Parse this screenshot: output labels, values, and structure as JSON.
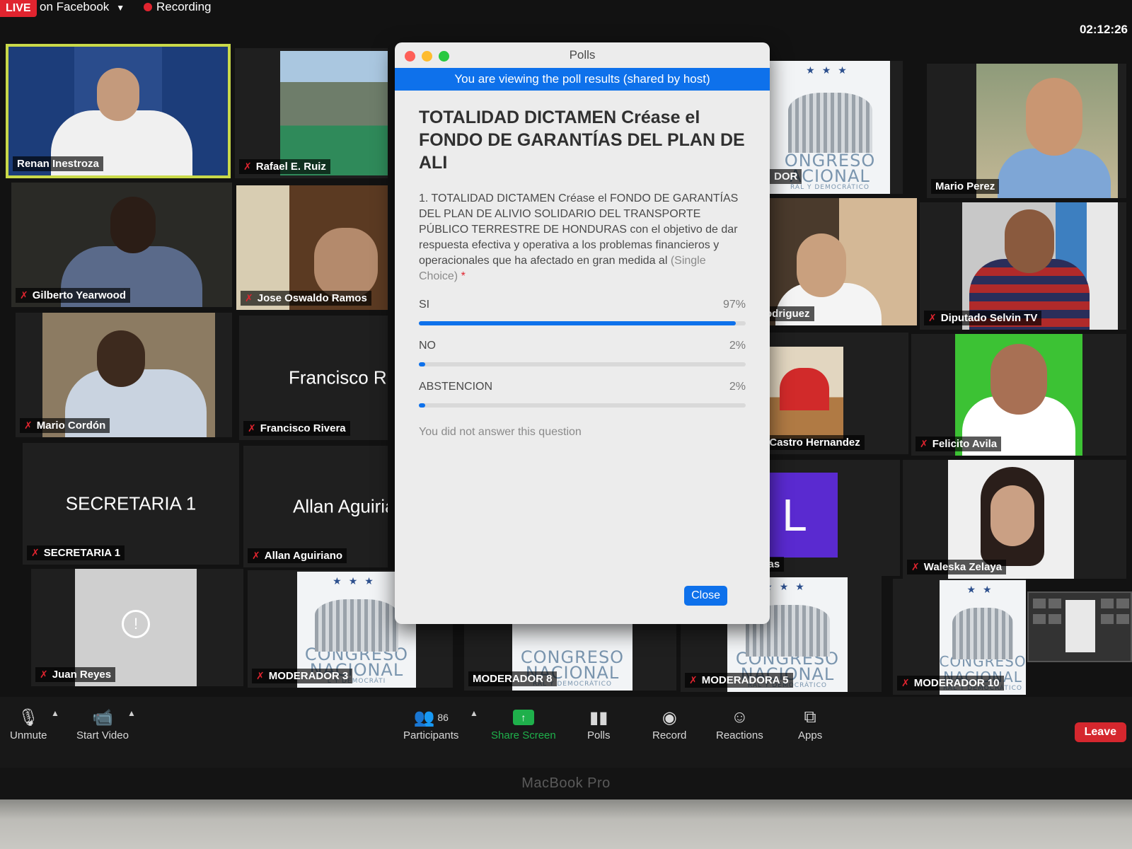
{
  "top_bar": {
    "live_label": "LIVE",
    "on_facebook": "on Facebook",
    "recording": "Recording",
    "clock": "02:12:26"
  },
  "tiles": [
    {
      "name": "Renan Inestroza"
    },
    {
      "name": "Rafael E. Ruiz"
    },
    {
      "name": "Gilberto Yearwood"
    },
    {
      "name": "Jose Oswaldo Ramos"
    },
    {
      "name": "Mario Cordón"
    },
    {
      "name": "Francisco Rivera",
      "center": "Francisco Riv"
    },
    {
      "name": "SECRETARIA 1",
      "center": "SECRETARIA 1"
    },
    {
      "name": "Allan Aguiriano",
      "center": "Allan Aguiria"
    },
    {
      "name": "Juan Reyes"
    },
    {
      "name": "MODERADOR 3"
    },
    {
      "name": "MODERADOR 8"
    },
    {
      "name": "MODERADORA 5"
    },
    {
      "name": "MODERADOR 10"
    },
    {
      "name": "Mario Perez"
    },
    {
      "name": "Diputado Selvin TV"
    },
    {
      "name": "Felicito Avila"
    },
    {
      "name": "Waleska Zelaya"
    },
    {
      "name": "DOR"
    },
    {
      "name": "odriguez"
    },
    {
      "name": "n Castro Hernandez"
    },
    {
      "name": "egas",
      "avatar_letter": "L"
    }
  ],
  "logo": {
    "line1": "CONGRESO",
    "line2": "NACIONAL",
    "line3": "RAL Y DEMOCRÁTICO",
    "line3_variant": "L Y DEMOCRÁTI",
    "logo1_line1": "ONGRESO",
    "logo1_line2": "ACIONAL"
  },
  "avila_banner": "CITO AVILA",
  "poll": {
    "window_title": "Polls",
    "shared_banner": "You are viewing the poll results (shared by host)",
    "title": "TOTALIDAD DICTAMEN  Créase el FONDO DE GARANTÍAS DEL PLAN DE ALI",
    "question": "1. TOTALIDAD DICTAMEN  Créase el FONDO DE GARANTÍAS DEL PLAN DE ALIVIO SOLIDARIO DEL TRANSPORTE PÚBLICO TERRESTRE DE HONDURAS con el objetivo de dar respuesta efectiva y operativa a los problemas financieros y operacionales que ha afectado en gran medida al",
    "choice_type": "(Single Choice)",
    "required": "*",
    "options": [
      {
        "label": "SI",
        "percent_label": "97%",
        "percent": 97
      },
      {
        "label": "NO",
        "percent_label": "2%",
        "percent": 2
      },
      {
        "label": "ABSTENCION",
        "percent_label": "2%",
        "percent": 2
      }
    ],
    "no_answer": "You did not answer this question",
    "close_label": "Close"
  },
  "toolbar": {
    "unmute": "Unmute",
    "start_video": "Start Video",
    "participants": "Participants",
    "participant_count": "86",
    "share_screen": "Share Screen",
    "polls": "Polls",
    "record": "Record",
    "reactions": "Reactions",
    "apps": "Apps",
    "leave": "Leave"
  },
  "device_label": "MacBook Pro",
  "colors": {
    "zoom_blue": "#0e71eb",
    "share_green": "#1fb04b",
    "leave_red": "#d5272e",
    "active_speaker": "#c9d949"
  }
}
